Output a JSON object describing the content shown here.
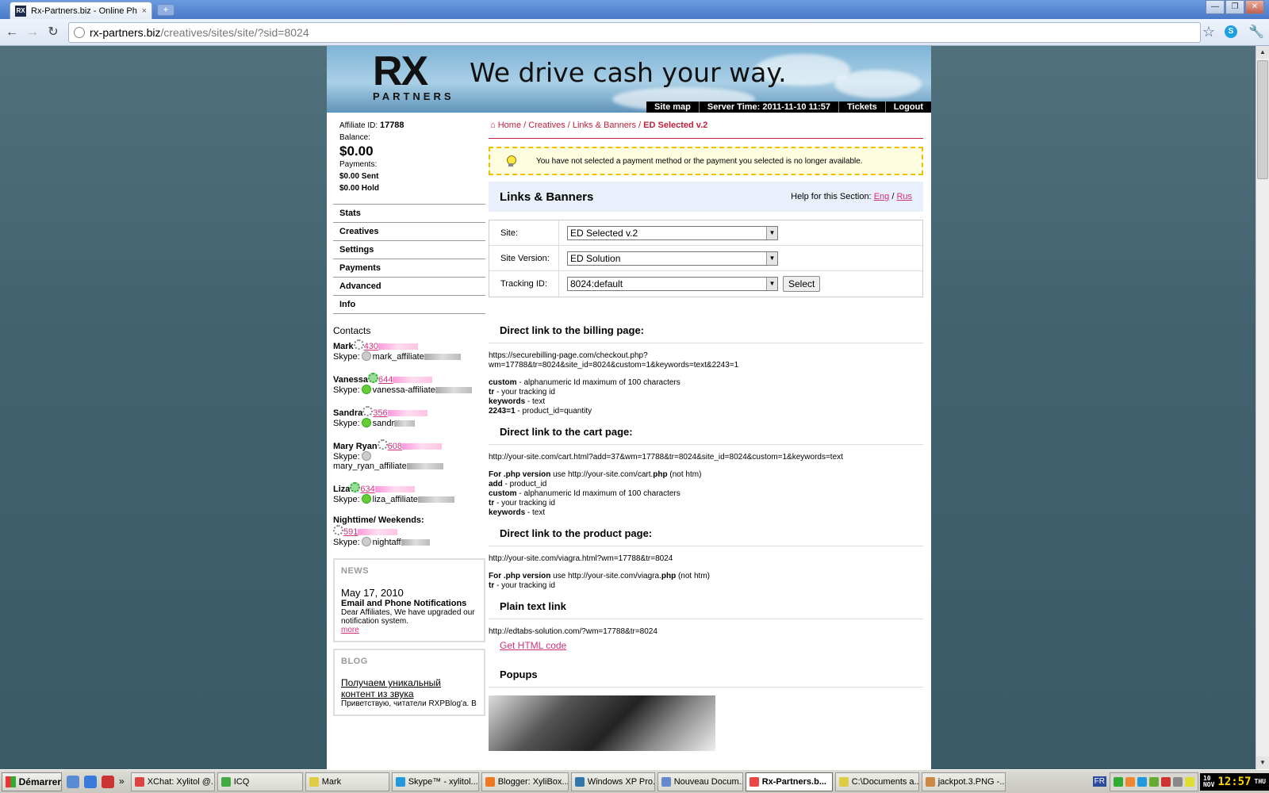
{
  "browser": {
    "tab_title": "Rx-Partners.biz - Online Pharm",
    "tab_close": "×",
    "new_tab": "+",
    "url_host": "rx-partners.biz",
    "url_path": "/creatives/sites/site/?sid=8024",
    "win_min": "—",
    "win_max": "❐",
    "win_close": "✕"
  },
  "header": {
    "logo_rx": "RX",
    "logo_partners": "PARTNERS",
    "tagline": "We drive cash your way.",
    "nav": [
      "Site map",
      "Server Time: 2011-11-10 11:57",
      "Tickets",
      "Logout"
    ]
  },
  "sidebar": {
    "affiliate_label": "Affiliate ID:",
    "affiliate_id": "17788",
    "balance_label": "Balance:",
    "balance": "$0.00",
    "payments_label": "Payments:",
    "sent": "$0.00 Sent",
    "hold": "$0.00 Hold",
    "menu": [
      "Stats",
      "Creatives",
      "Settings",
      "Payments",
      "Advanced",
      "Info"
    ],
    "contacts_title": "Contacts",
    "contacts": [
      {
        "name": "Mark",
        "phone": "430",
        "skype_label": "Skype:",
        "skype": "mark_affiliate"
      },
      {
        "name": "Vanessa",
        "phone": "644",
        "skype_label": "Skype:",
        "skype": "vanessa-affiliate"
      },
      {
        "name": "Sandra",
        "phone": "356",
        "skype_label": "Skype:",
        "skype": "sandr"
      },
      {
        "name": "Mary Ryan",
        "phone": "608",
        "skype_label": "Skype:",
        "skype": "mary_ryan_affiliate"
      },
      {
        "name": "Liza",
        "phone": "634",
        "skype_label": "Skype:",
        "skype": "liza_affiliate"
      },
      {
        "name": "Nighttime/ Weekends:",
        "phone": "591",
        "skype_label": "Skype:",
        "skype": "nightaff"
      }
    ],
    "news_head": "NEWS",
    "news_date": "May 17, 2010",
    "news_title": "Email and Phone Notifications",
    "news_text": "Dear Affiliates, We have upgraded our notification system.",
    "news_more": "more",
    "blog_head": "BLOG",
    "blog_title": "Получаем уникальный контент из звука",
    "blog_text": "Приветствую, читатели RXPBlog'a. В"
  },
  "main": {
    "crumbs": [
      "Home",
      "Creatives",
      "Links & Banners"
    ],
    "crumb_current": "ED Selected v.2",
    "crumb_sep": " / ",
    "warning": "You have not selected a payment method or the payment you selected is no longer available.",
    "section_title": "Links & Banners",
    "help_label": "Help for this Section:",
    "help_eng": "Eng",
    "help_sep": " / ",
    "help_rus": "Rus",
    "form": {
      "site_label": "Site:",
      "site_value": "ED Selected v.2",
      "version_label": "Site Version:",
      "version_value": "ED Solution",
      "tracking_label": "Tracking ID:",
      "tracking_value": "8024:default",
      "select_button": "Select"
    },
    "billing": {
      "title": "Direct link to the billing page:",
      "url1": "https://securebilling-page.com/checkout.php?",
      "url2": "wm=17788&tr=8024&site_id=8024&custom=1&keywords=text&2243=1",
      "lines": [
        {
          "k": "custom",
          "v": " - alphanumeric Id maximum of 100 characters"
        },
        {
          "k": "tr",
          "v": " - your tracking id"
        },
        {
          "k": "keywords",
          "v": " - text"
        },
        {
          "k": "2243=1",
          "v": " - product_id=quantity"
        }
      ]
    },
    "cart": {
      "title": "Direct link to the cart page:",
      "url": "http://your-site.com/cart.html?add=37&wm=17788&tr=8024&site_id=8024&custom=1&keywords=text",
      "php_k": "For .php version",
      "php_v": " use http://your-site.com/cart.",
      "php_b": "php",
      "php_e": " (not htm)",
      "lines": [
        {
          "k": "add",
          "v": " - product_id"
        },
        {
          "k": "custom",
          "v": " - alphanumeric Id maximum of 100 characters"
        },
        {
          "k": "tr",
          "v": " - your tracking id"
        },
        {
          "k": "keywords",
          "v": " - text"
        }
      ]
    },
    "product": {
      "title": "Direct link to the product page:",
      "url": "http://your-site.com/viagra.html?wm=17788&tr=8024",
      "php_k": "For .php version",
      "php_v": " use http://your-site.com/viagra.",
      "php_b": "php",
      "php_e": " (not htm)",
      "tr_k": "tr",
      "tr_v": " - your tracking id"
    },
    "plain": {
      "title": "Plain text link",
      "url": "http://edtabs-solution.com/?wm=17788&tr=8024",
      "html_link": "Get HTML code"
    },
    "popups_title": "Popups"
  },
  "taskbar": {
    "start": "Démarrer",
    "chevron": "»",
    "tasks": [
      "XChat: Xylitol @...",
      "ICQ",
      "Mark",
      "Skype™ - xylitol...",
      "Blogger: XyliBox...",
      "Windows XP Pro...",
      "Nouveau Docum...",
      "Rx-Partners.b...",
      "C:\\Documents a...",
      "jackpot.3.PNG -..."
    ],
    "active_index": 7,
    "lang": "FR",
    "clock_day": "10",
    "clock_month": "NOV",
    "clock_time": "12:57",
    "clock_dow": "THU"
  },
  "colors": {
    "accent": "#c0203a",
    "link": "#d0307a",
    "warn_border": "#f0c000"
  }
}
